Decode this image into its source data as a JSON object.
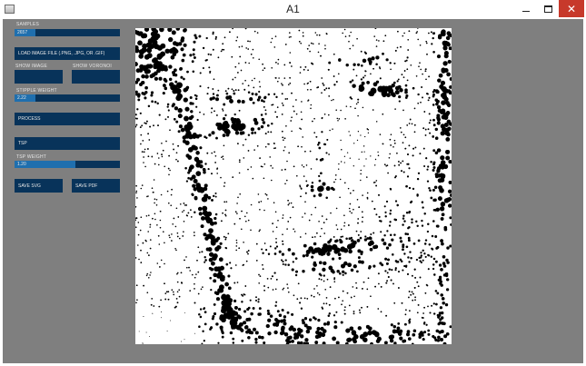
{
  "window": {
    "title": "A1",
    "icon": "app-window-icon",
    "buttons": {
      "minimize": "minimize-icon",
      "maximize": "maximize-icon",
      "close": "close-icon",
      "close_glyph": "✕"
    }
  },
  "colors": {
    "panel_bg": "#7f7f7f",
    "control_bg": "#08335a",
    "control_fill": "#1f6fae",
    "text": "#e6e6e6",
    "close": "#c7392b"
  },
  "controls": {
    "samples": {
      "label": "SAMPLES",
      "value": "2657",
      "fill_fraction": 0.2
    },
    "load_image": {
      "label": "LOAD IMAGE FILE (.PNG, .JPG, OR .GIF)"
    },
    "show_image": {
      "label": "SHOW IMAGE"
    },
    "show_voronoi": {
      "label": "SHOW VORONOI"
    },
    "stipple_weight": {
      "label": "STIPPLE WEIGHT",
      "value": "2.22",
      "fill_fraction": 0.2
    },
    "process": {
      "label": "PROCESS"
    },
    "tsp": {
      "label": "TSP"
    },
    "tsp_weight": {
      "label": "TSP WEIGHT",
      "value": "1.20",
      "fill_fraction": 0.58
    },
    "save_svg": {
      "label": "SAVE SVG"
    },
    "save_pdf": {
      "label": "SAVE PDF"
    }
  }
}
